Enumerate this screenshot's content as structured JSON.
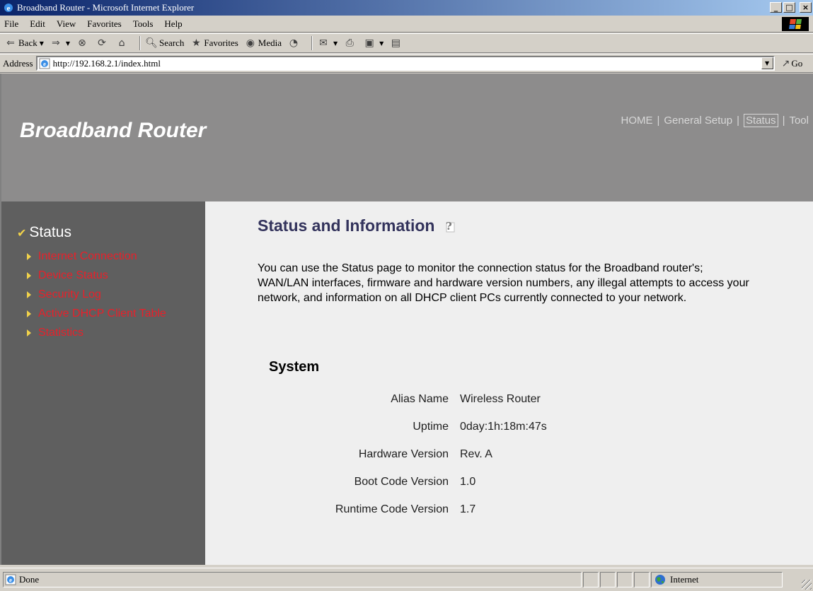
{
  "window": {
    "title": "Broadband Router - Microsoft Internet Explorer"
  },
  "menu": [
    "File",
    "Edit",
    "View",
    "Favorites",
    "Tools",
    "Help"
  ],
  "toolbar": {
    "back_label": "Back",
    "search_label": "Search",
    "favorites_label": "Favorites",
    "media_label": "Media"
  },
  "address": {
    "label": "Address",
    "url": "http://192.168.2.1/index.html",
    "go_label": "Go"
  },
  "header": {
    "brand": "Broadband Router",
    "nav": [
      "HOME",
      "General Setup",
      "Status",
      "Tool"
    ]
  },
  "sidebar": {
    "title": "Status",
    "links": [
      "Internet Connection",
      "Device Status",
      "Security Log",
      "Active DHCP Client Table",
      "Statistics"
    ]
  },
  "main": {
    "title": "Status and Information",
    "description": "You can use the Status page to monitor the connection status for the Broadband router's; WAN/LAN interfaces, firmware and hardware version numbers, any illegal attempts to access your network, and information on all DHCP client PCs currently connected to your network.",
    "section_title": "System",
    "system": [
      {
        "key": "Alias Name",
        "value": "Wireless Router"
      },
      {
        "key": "Uptime",
        "value": "0day:1h:18m:47s"
      },
      {
        "key": "Hardware Version",
        "value": "Rev. A"
      },
      {
        "key": "Boot Code Version",
        "value": "1.0"
      },
      {
        "key": "Runtime Code Version",
        "value": "1.7"
      }
    ]
  },
  "status": {
    "text": "Done",
    "zone": "Internet"
  }
}
